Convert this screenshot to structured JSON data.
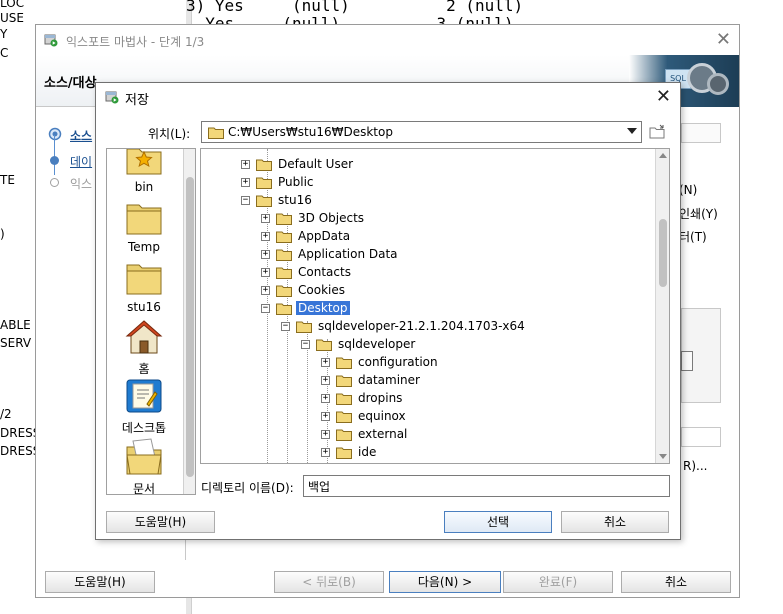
{
  "background": {
    "left_fragments": [
      "LOC",
      "USE",
      "Y",
      "C",
      "TE",
      ")",
      "ABLE",
      "SERV",
      "/2",
      "DRESS",
      "DRESS"
    ],
    "grid_rows": [
      "3) Yes     (null)          2 (null)",
      "  Yes     (null)          3 (null)"
    ]
  },
  "wizard": {
    "title": "익스포트 마법사 - 단계 1/3",
    "header_title": "소스/대상",
    "steps": [
      {
        "label": "소스"
      },
      {
        "label": "데이"
      },
      {
        "label": "익스"
      }
    ],
    "right_stubs": [
      "(N)",
      "인쇄(Y)",
      "터(T)",
      "R)..."
    ],
    "buttons": {
      "help": "도움말(H)",
      "back": "< 뒤로(B)",
      "next": "다음(N) >",
      "finish": "완료(F)",
      "cancel": "취소"
    }
  },
  "save_dialog": {
    "title": "저장",
    "location_label": "위치(L):",
    "location_value": "C:₩Users₩stu16₩Desktop",
    "places": [
      {
        "label": "bin",
        "icon": "star-folder-icon"
      },
      {
        "label": "Temp",
        "icon": "folder-icon"
      },
      {
        "label": "stu16",
        "icon": "folder-icon"
      },
      {
        "label": "홈",
        "icon": "home-icon"
      },
      {
        "label": "데스크톱",
        "icon": "desktop-icon"
      },
      {
        "label": "문서",
        "icon": "documents-icon"
      }
    ],
    "tree": [
      {
        "label": "Default User",
        "level": 2,
        "expander": "+"
      },
      {
        "label": "Public",
        "level": 2,
        "expander": "+"
      },
      {
        "label": "stu16",
        "level": 2,
        "expander": "-"
      },
      {
        "label": "3D Objects",
        "level": 3,
        "expander": "+"
      },
      {
        "label": "AppData",
        "level": 3,
        "expander": "+"
      },
      {
        "label": "Application Data",
        "level": 3,
        "expander": "+"
      },
      {
        "label": "Contacts",
        "level": 3,
        "expander": "+"
      },
      {
        "label": "Cookies",
        "level": 3,
        "expander": "+"
      },
      {
        "label": "Desktop",
        "level": 3,
        "expander": "-",
        "selected": true
      },
      {
        "label": "sqldeveloper-21.2.1.204.1703-x64",
        "level": 4,
        "expander": "-"
      },
      {
        "label": "sqldeveloper",
        "level": 5,
        "expander": "-"
      },
      {
        "label": "configuration",
        "level": 6,
        "expander": "+"
      },
      {
        "label": "dataminer",
        "level": 6,
        "expander": "+"
      },
      {
        "label": "dropins",
        "level": 6,
        "expander": "+"
      },
      {
        "label": "equinox",
        "level": 6,
        "expander": "+"
      },
      {
        "label": "external",
        "level": 6,
        "expander": "+"
      },
      {
        "label": "ide",
        "level": 6,
        "expander": "+"
      }
    ],
    "dir_name_label": "디렉토리 이름(D):",
    "dir_name_value": "백업",
    "buttons": {
      "help": "도움말(H)",
      "select": "선택",
      "cancel": "취소"
    }
  }
}
